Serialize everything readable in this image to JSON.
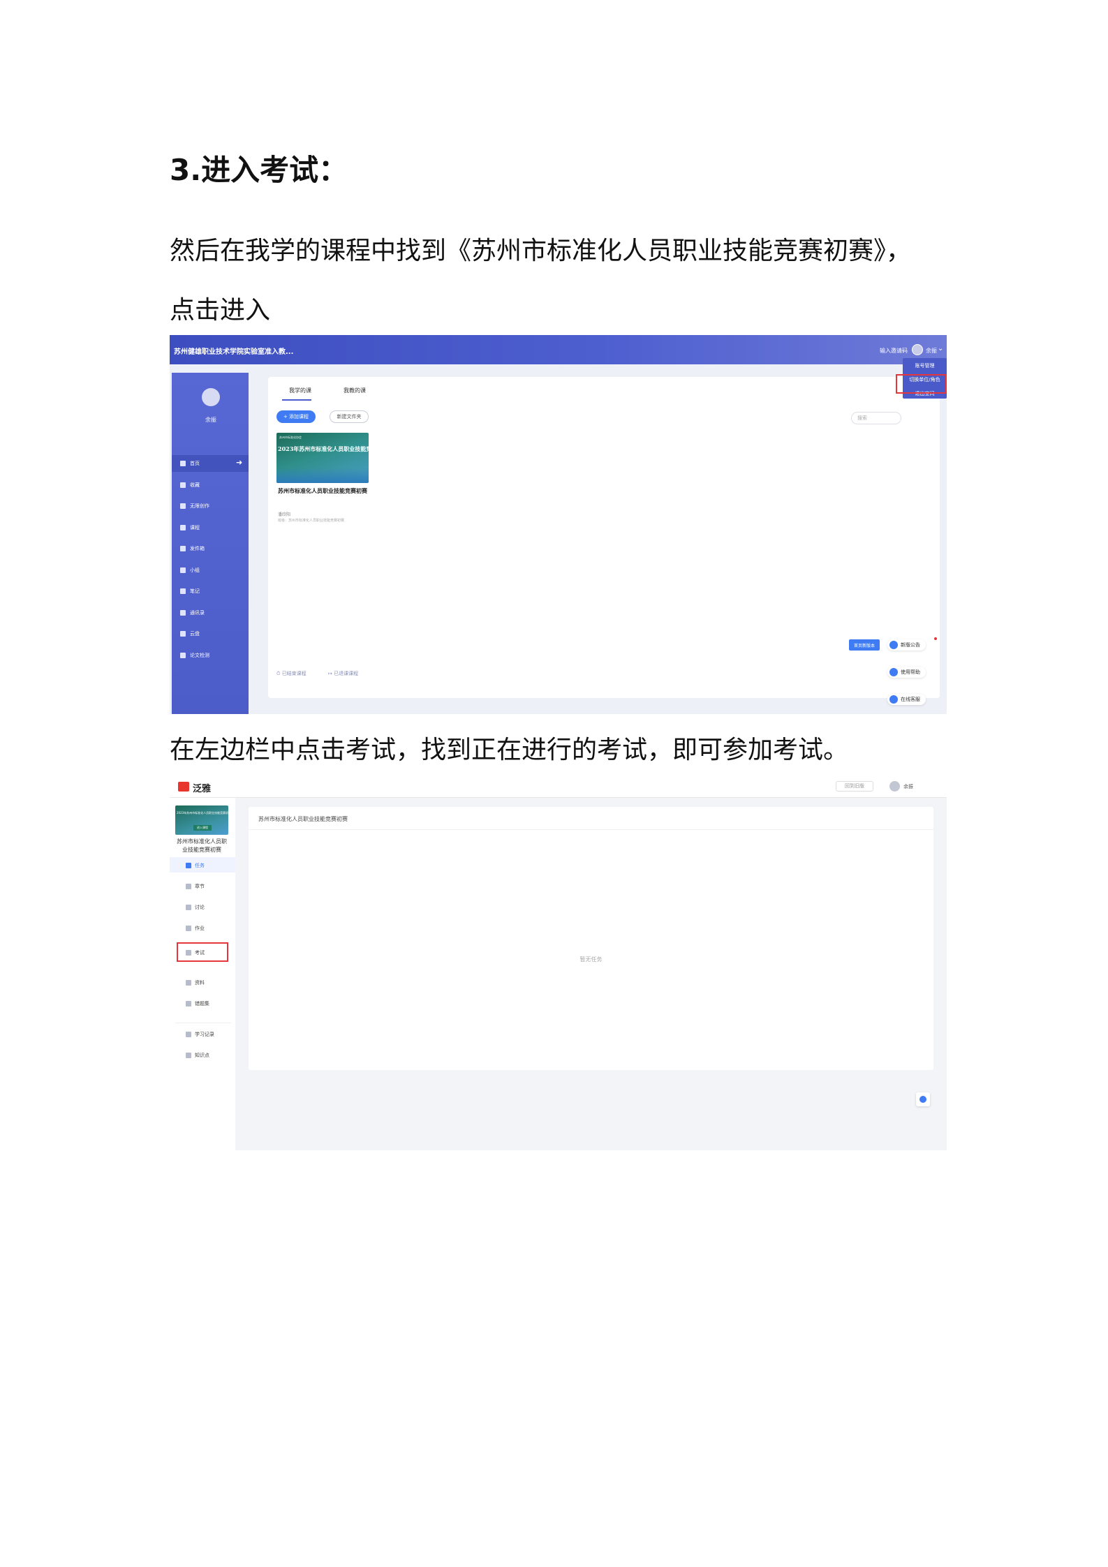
{
  "heading": "3.进入考试：",
  "para1_line1": "然后在我学的课程中找到《苏州市标准化人员职业技能竞赛初赛》，",
  "para1_line2": "点击进入",
  "para2": "在左边栏中点击考试，找到正在进行的考试，即可参加考试。",
  "screenshot1": {
    "header_title": "苏州健雄职业技术学院实验室准入教...",
    "invite_code": "输入邀请码",
    "user_name": "余振",
    "caret": "⌄",
    "sidebar_user": "余振",
    "sidebar_items": [
      "首页",
      "收藏",
      "无限创作",
      "课程",
      "发件箱",
      "小组",
      "笔记",
      "通讯录",
      "云盘",
      "论文检测"
    ],
    "tabs": [
      "我学的课",
      "我教的课"
    ],
    "add_course": "+ 添加课程",
    "new_folder": "新建文件夹",
    "search_placeholder": "搜索",
    "cover_top": "苏州市标准化协会",
    "cover_title": "2023年苏州市标准化人员职业技能竞",
    "course_name": "苏州市标准化人员职业技能竞赛初赛",
    "teacher": "潘欣阳",
    "class_info": "班级：苏州市标准化人员职业技能竞赛初赛",
    "footer_links": [
      "已结束课程",
      "已退课课程"
    ],
    "dropdown": [
      "账号管理",
      "切换单位/角色",
      "退出空间"
    ],
    "blue_button": "首页新版本",
    "float_buttons": [
      "新版公告",
      "使用帮助",
      "在线客服"
    ],
    "colors": {
      "header": "#3d4ec0",
      "sidebar": "#5767d3",
      "accent": "#3f7cf3",
      "highlight": "#e5363b"
    }
  },
  "screenshot2": {
    "logo_text": "泛雅",
    "old_version": "回到旧版",
    "user_name": "余振",
    "cover_text": "2023年苏州市标准化人员职业技能竞赛初赛",
    "cover_button": "进入课程",
    "course_name": "苏州市标准化人员职业技能竞赛初赛",
    "nav_items": [
      "任务",
      "章节",
      "讨论",
      "作业",
      "考试",
      "资料",
      "错题集"
    ],
    "nav_items_bottom": [
      "学习记录",
      "知识点"
    ],
    "main_title": "苏州市标准化人员职业技能竞赛初赛",
    "empty_text": "暂无任务",
    "colors": {
      "accent": "#3f7cf3",
      "logo": "#e8362f",
      "highlight": "#e5363b"
    }
  }
}
